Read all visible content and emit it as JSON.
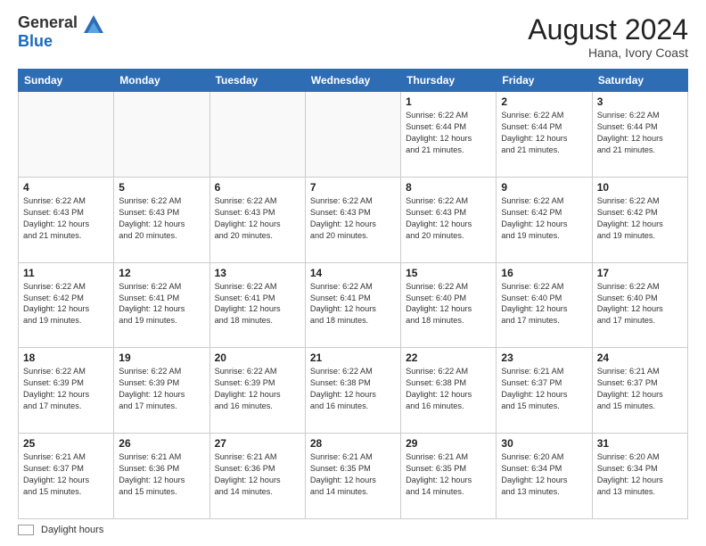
{
  "header": {
    "logo_general": "General",
    "logo_blue": "Blue",
    "month_year": "August 2024",
    "location": "Hana, Ivory Coast"
  },
  "days_of_week": [
    "Sunday",
    "Monday",
    "Tuesday",
    "Wednesday",
    "Thursday",
    "Friday",
    "Saturday"
  ],
  "weeks": [
    [
      {
        "day": "",
        "info": ""
      },
      {
        "day": "",
        "info": ""
      },
      {
        "day": "",
        "info": ""
      },
      {
        "day": "",
        "info": ""
      },
      {
        "day": "1",
        "info": "Sunrise: 6:22 AM\nSunset: 6:44 PM\nDaylight: 12 hours\nand 21 minutes."
      },
      {
        "day": "2",
        "info": "Sunrise: 6:22 AM\nSunset: 6:44 PM\nDaylight: 12 hours\nand 21 minutes."
      },
      {
        "day": "3",
        "info": "Sunrise: 6:22 AM\nSunset: 6:44 PM\nDaylight: 12 hours\nand 21 minutes."
      }
    ],
    [
      {
        "day": "4",
        "info": "Sunrise: 6:22 AM\nSunset: 6:43 PM\nDaylight: 12 hours\nand 21 minutes."
      },
      {
        "day": "5",
        "info": "Sunrise: 6:22 AM\nSunset: 6:43 PM\nDaylight: 12 hours\nand 20 minutes."
      },
      {
        "day": "6",
        "info": "Sunrise: 6:22 AM\nSunset: 6:43 PM\nDaylight: 12 hours\nand 20 minutes."
      },
      {
        "day": "7",
        "info": "Sunrise: 6:22 AM\nSunset: 6:43 PM\nDaylight: 12 hours\nand 20 minutes."
      },
      {
        "day": "8",
        "info": "Sunrise: 6:22 AM\nSunset: 6:43 PM\nDaylight: 12 hours\nand 20 minutes."
      },
      {
        "day": "9",
        "info": "Sunrise: 6:22 AM\nSunset: 6:42 PM\nDaylight: 12 hours\nand 19 minutes."
      },
      {
        "day": "10",
        "info": "Sunrise: 6:22 AM\nSunset: 6:42 PM\nDaylight: 12 hours\nand 19 minutes."
      }
    ],
    [
      {
        "day": "11",
        "info": "Sunrise: 6:22 AM\nSunset: 6:42 PM\nDaylight: 12 hours\nand 19 minutes."
      },
      {
        "day": "12",
        "info": "Sunrise: 6:22 AM\nSunset: 6:41 PM\nDaylight: 12 hours\nand 19 minutes."
      },
      {
        "day": "13",
        "info": "Sunrise: 6:22 AM\nSunset: 6:41 PM\nDaylight: 12 hours\nand 18 minutes."
      },
      {
        "day": "14",
        "info": "Sunrise: 6:22 AM\nSunset: 6:41 PM\nDaylight: 12 hours\nand 18 minutes."
      },
      {
        "day": "15",
        "info": "Sunrise: 6:22 AM\nSunset: 6:40 PM\nDaylight: 12 hours\nand 18 minutes."
      },
      {
        "day": "16",
        "info": "Sunrise: 6:22 AM\nSunset: 6:40 PM\nDaylight: 12 hours\nand 17 minutes."
      },
      {
        "day": "17",
        "info": "Sunrise: 6:22 AM\nSunset: 6:40 PM\nDaylight: 12 hours\nand 17 minutes."
      }
    ],
    [
      {
        "day": "18",
        "info": "Sunrise: 6:22 AM\nSunset: 6:39 PM\nDaylight: 12 hours\nand 17 minutes."
      },
      {
        "day": "19",
        "info": "Sunrise: 6:22 AM\nSunset: 6:39 PM\nDaylight: 12 hours\nand 17 minutes."
      },
      {
        "day": "20",
        "info": "Sunrise: 6:22 AM\nSunset: 6:39 PM\nDaylight: 12 hours\nand 16 minutes."
      },
      {
        "day": "21",
        "info": "Sunrise: 6:22 AM\nSunset: 6:38 PM\nDaylight: 12 hours\nand 16 minutes."
      },
      {
        "day": "22",
        "info": "Sunrise: 6:22 AM\nSunset: 6:38 PM\nDaylight: 12 hours\nand 16 minutes."
      },
      {
        "day": "23",
        "info": "Sunrise: 6:21 AM\nSunset: 6:37 PM\nDaylight: 12 hours\nand 15 minutes."
      },
      {
        "day": "24",
        "info": "Sunrise: 6:21 AM\nSunset: 6:37 PM\nDaylight: 12 hours\nand 15 minutes."
      }
    ],
    [
      {
        "day": "25",
        "info": "Sunrise: 6:21 AM\nSunset: 6:37 PM\nDaylight: 12 hours\nand 15 minutes."
      },
      {
        "day": "26",
        "info": "Sunrise: 6:21 AM\nSunset: 6:36 PM\nDaylight: 12 hours\nand 15 minutes."
      },
      {
        "day": "27",
        "info": "Sunrise: 6:21 AM\nSunset: 6:36 PM\nDaylight: 12 hours\nand 14 minutes."
      },
      {
        "day": "28",
        "info": "Sunrise: 6:21 AM\nSunset: 6:35 PM\nDaylight: 12 hours\nand 14 minutes."
      },
      {
        "day": "29",
        "info": "Sunrise: 6:21 AM\nSunset: 6:35 PM\nDaylight: 12 hours\nand 14 minutes."
      },
      {
        "day": "30",
        "info": "Sunrise: 6:20 AM\nSunset: 6:34 PM\nDaylight: 12 hours\nand 13 minutes."
      },
      {
        "day": "31",
        "info": "Sunrise: 6:20 AM\nSunset: 6:34 PM\nDaylight: 12 hours\nand 13 minutes."
      }
    ]
  ],
  "footer": {
    "legend_label": "Daylight hours"
  }
}
